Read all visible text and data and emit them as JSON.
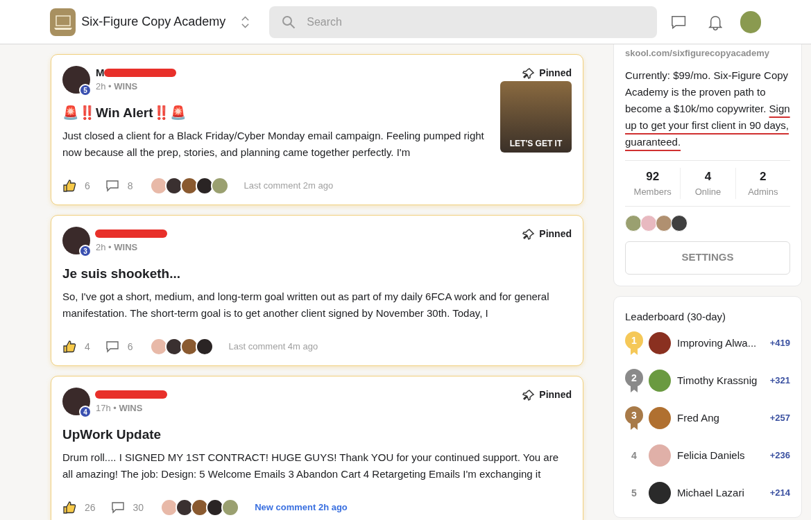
{
  "header": {
    "community": "Six-Figure Copy Academy",
    "search": {
      "placeholder": "Search"
    }
  },
  "posts": [
    {
      "author": "M",
      "redacted": true,
      "level": "5",
      "time": "2h •",
      "category": "WINS",
      "pinned_label": "Pinned",
      "title": "🚨‼️Win Alert‼️🚨",
      "body": "Just closed a client for a Black Friday/Cyber Monday email campaign. Feeling pumped right now because all the prep, stories, and planning came together perfectly. I'm",
      "has_image": true,
      "image_caption": "LET'S GET IT",
      "liked": true,
      "likes": "6",
      "comments": "8",
      "commenters": [
        {
          "kind": "photo"
        },
        {
          "kind": "photo"
        },
        {
          "kind": "photo"
        },
        {
          "kind": "photo"
        },
        {
          "kind": "photo"
        }
      ],
      "last_comment": "Last comment 2m ago",
      "new_comment": false
    },
    {
      "redacted": true,
      "level": "3",
      "time": "2h •",
      "category": "WINS",
      "pinned_label": "Pinned",
      "title": "Je suis shooketh...",
      "body": "So, I've got a short, medium, and long-term goal written out as part of my daily 6FCA work and for general manifestation. The short-term goal is to get another client signed by November 30th. Today, I",
      "has_image": false,
      "liked": true,
      "likes": "4",
      "comments": "6",
      "commenters": [
        {
          "kind": "photo"
        },
        {
          "kind": "photo"
        },
        {
          "kind": "photo"
        },
        {
          "kind": "photo"
        }
      ],
      "last_comment": "Last comment 4m ago",
      "new_comment": false
    },
    {
      "redacted": true,
      "level": "4",
      "time": "17h •",
      "category": "WINS",
      "pinned_label": "Pinned",
      "title": "UpWork Update",
      "body": "Drum roll.... I SIGNED MY 1ST CONTRACT! HUGE GUYS! Thank YOU for your continued support. You are all amazing! The job: Design: 5 Welcome Emails 3 Abandon Cart 4 Retargeting Emails I'm exchanging it",
      "has_image": false,
      "liked": true,
      "likes": "26",
      "comments": "30",
      "commenters": [
        {
          "kind": "photo"
        },
        {
          "kind": "photo"
        },
        {
          "kind": "photo"
        },
        {
          "kind": "photo"
        },
        {
          "kind": "photo"
        }
      ],
      "last_comment": "New comment 2h ago",
      "new_comment": true
    }
  ],
  "about": {
    "url": "skool.com/sixfigurecopyacademy",
    "description": "Currently: $99/mo. Six-Figure Copy Academy is the proven path to become a $10k/mo copywriter. ",
    "highlight": "Sign up to get your first client in 90 days, guaranteed.",
    "stats": [
      {
        "value": "92",
        "label": "Members"
      },
      {
        "value": "4",
        "label": "Online"
      },
      {
        "value": "2",
        "label": "Admins"
      }
    ],
    "admin_avatars": [
      {
        "kind": "photo"
      },
      {
        "kind": "photo"
      },
      {
        "kind": "photo"
      },
      {
        "kind": "photo"
      }
    ],
    "settings_button": "SETTINGS"
  },
  "leaderboard": {
    "title": "Leaderboard (30-day)",
    "entries": [
      {
        "rank": "1",
        "kind": "medal",
        "color": "#f5c858",
        "name": "Improving Alwa...",
        "points": "+419"
      },
      {
        "rank": "2",
        "kind": "medal",
        "color": "#8a8a8a",
        "name": "Timothy Krassnig",
        "points": "+321"
      },
      {
        "rank": "3",
        "kind": "medal",
        "color": "#a87a48",
        "name": "Fred Ang",
        "points": "+257"
      },
      {
        "rank": "4",
        "kind": "plain",
        "name": "Felicia Daniels",
        "points": "+236"
      },
      {
        "rank": "5",
        "kind": "plain",
        "name": "Michael Lazari",
        "points": "+214"
      }
    ]
  }
}
